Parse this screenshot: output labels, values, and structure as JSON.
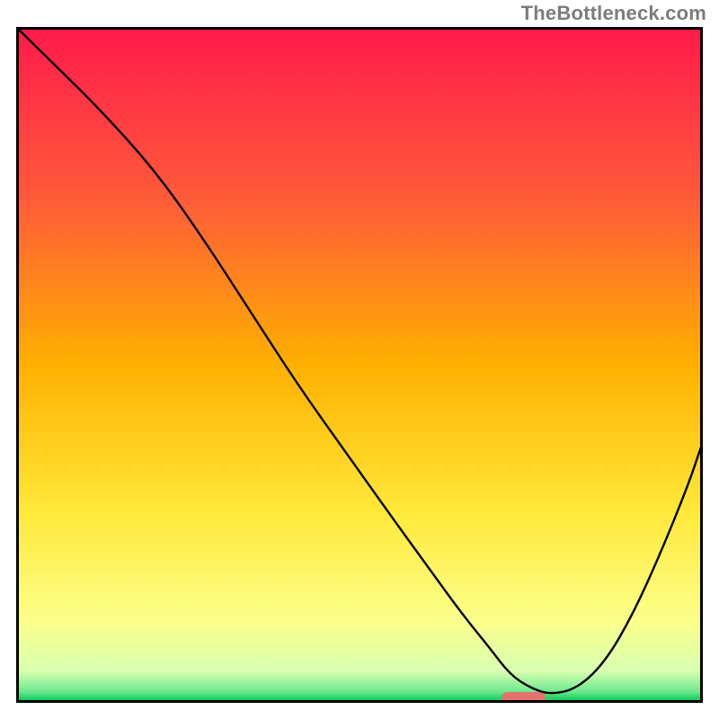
{
  "watermark": "TheBottleneck.com",
  "chart_data": {
    "type": "line",
    "title": "",
    "xlabel": "",
    "ylabel": "",
    "xlim": [
      0,
      100
    ],
    "ylim": [
      0,
      100
    ],
    "grid": false,
    "legend": false,
    "background_gradient_stops": [
      {
        "offset": 0.0,
        "color": "#ff1a4b"
      },
      {
        "offset": 0.25,
        "color": "#ff5a3a"
      },
      {
        "offset": 0.5,
        "color": "#ffb000"
      },
      {
        "offset": 0.72,
        "color": "#ffe93a"
      },
      {
        "offset": 0.88,
        "color": "#fbff8a"
      },
      {
        "offset": 0.955,
        "color": "#d8ffb0"
      },
      {
        "offset": 0.985,
        "color": "#6fe88f"
      },
      {
        "offset": 1.0,
        "color": "#00c853"
      }
    ],
    "curve": {
      "x": [
        0,
        5,
        12,
        20,
        27,
        34,
        41,
        48,
        55,
        60,
        65,
        69,
        72,
        75,
        78,
        82,
        86,
        90,
        94,
        98,
        100
      ],
      "y": [
        100,
        95,
        88,
        79,
        69,
        58,
        47,
        37,
        27,
        20,
        13,
        8,
        4,
        2,
        1,
        2,
        6,
        13,
        22,
        32,
        38
      ]
    },
    "marker": {
      "x_center": 74,
      "x_halfwidth": 3.2,
      "y": 0.6,
      "color": "#e4736f",
      "height": 1.6
    },
    "frame_color": "#000000",
    "curve_color": "#000000",
    "curve_width": 2.4
  }
}
